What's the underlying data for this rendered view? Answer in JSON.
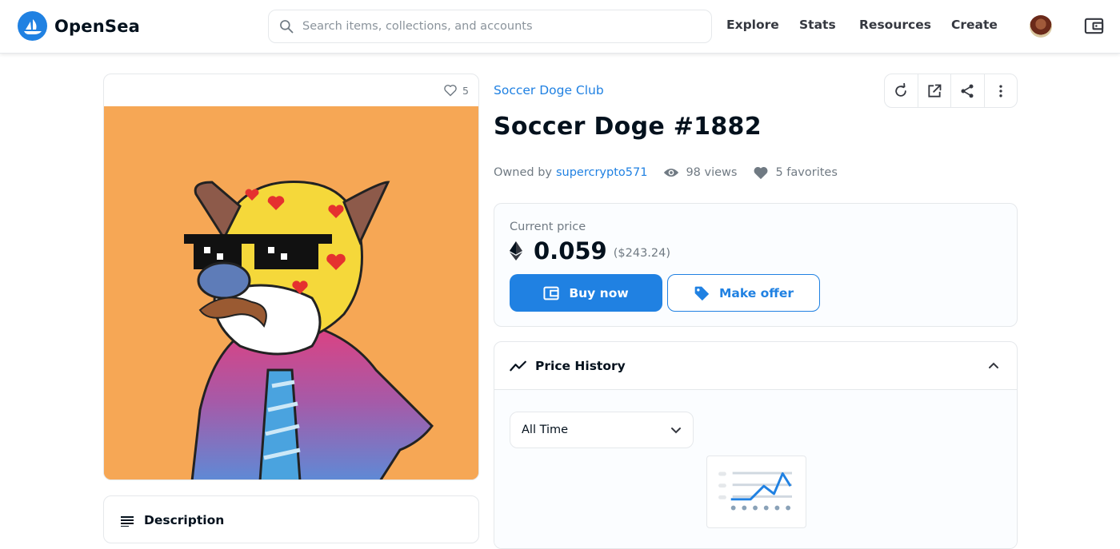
{
  "nav": {
    "brand": "OpenSea",
    "search_placeholder": "Search items, collections, and accounts",
    "links": [
      "Explore",
      "Stats",
      "Resources",
      "Create"
    ]
  },
  "item": {
    "favorites_count": "5",
    "collection": "Soccer Doge Club",
    "title": "Soccer Doge #1882",
    "owned_by_label": "Owned by",
    "owner": "supercrypto571",
    "views": "98 views",
    "favorites": "5 favorites"
  },
  "price": {
    "label": "Current price",
    "value": "0.059",
    "usd": "($243.24)",
    "buy_label": "Buy now",
    "offer_label": "Make offer"
  },
  "history": {
    "title": "Price History",
    "range": "All Time"
  },
  "description": {
    "title": "Description"
  },
  "colors": {
    "accent": "#2081e2",
    "image_bg": "#f6a755"
  }
}
